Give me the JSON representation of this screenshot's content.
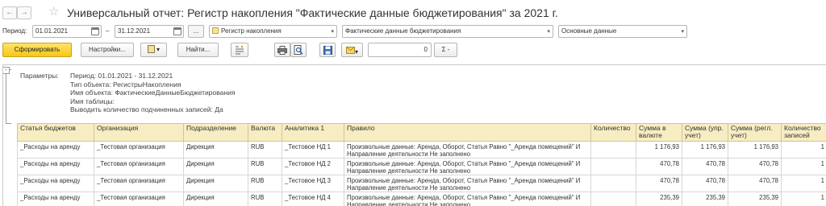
{
  "window": {
    "title": "Универсальный отчет: Регистр накопления \"Фактические данные бюджетирования\" за 2021 г.",
    "back_icon": "←",
    "forward_icon": "→",
    "favorite_icon": "☆"
  },
  "period_row": {
    "label": "Период:",
    "date_from": "01.01.2021",
    "dash": "–",
    "date_to": "31.12.2021",
    "choose_period": "...",
    "source_type": "Регистр накопления",
    "source_name": "Фактические данные бюджетирования",
    "data_mode": "Основные данные",
    "dropdown_arrow": "▾"
  },
  "toolbar": {
    "generate": "Сформировать",
    "settings": "Настройки...",
    "variants_icon": "▾",
    "find": "Найти...",
    "print_icon": "print",
    "preview_icon": "preview",
    "save_icon": "save",
    "mail_icon": "mail",
    "sum_value": "0",
    "sum_label": "Σ -"
  },
  "params": {
    "label": "Параметры:",
    "lines": [
      "Период: 01.01.2021 - 31.12.2021",
      "Тип объекта: РегистрыНакопления",
      "Имя объекта: ФактическиеДанныеБюджетирования",
      "Имя таблицы:",
      "Выводить количество подчиненных записей: Да"
    ]
  },
  "table": {
    "columns": [
      "Статья бюджетов",
      "Организация",
      "Подразделение",
      "Валюта",
      "Аналитика 1",
      "Правило",
      "Количество",
      "Сумма в валюте",
      "Сумма (упр. учет)",
      "Сумма (регл. учет)",
      "Количество записей"
    ],
    "rows": [
      [
        "_Расходы на аренду",
        "_Тестовая организация",
        "Дирекция",
        "RUB",
        "_Тестовое НД 1",
        "Произвольные данные: Аренда, Оборот, Статья Равно \"_Аренда помещений\" И Направление деятельности Не заполнено",
        "",
        "1 176,93",
        "1 176,93",
        "1 176,93",
        "1"
      ],
      [
        "_Расходы на аренду",
        "_Тестовая организация",
        "Дирекция",
        "RUB",
        "_Тестовое НД 2",
        "Произвольные данные: Аренда, Оборот, Статья Равно \"_Аренда помещений\" И Направление деятельности Не заполнено",
        "",
        "470,78",
        "470,78",
        "470,78",
        "1"
      ],
      [
        "_Расходы на аренду",
        "_Тестовая организация",
        "Дирекция",
        "RUB",
        "_Тестовое НД 3",
        "Произвольные данные: Аренда, Оборот, Статья Равно \"_Аренда помещений\" И Направление деятельности Не заполнено",
        "",
        "470,78",
        "470,78",
        "470,78",
        "1"
      ],
      [
        "_Расходы на аренду",
        "_Тестовая организация",
        "Дирекция",
        "RUB",
        "_Тестовое НД 4",
        "Произвольные данные: Аренда, Оборот, Статья Равно \"_Аренда помещений\" И Направление деятельности Не заполнено",
        "",
        "235,39",
        "235,39",
        "235,39",
        "1"
      ]
    ]
  }
}
